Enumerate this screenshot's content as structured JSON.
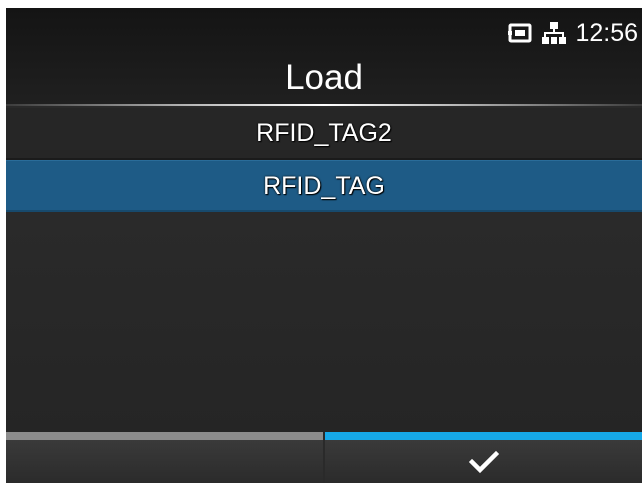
{
  "status_bar": {
    "time": "12:56",
    "icons": [
      "storage-card-icon",
      "network-lan-icon"
    ]
  },
  "header": {
    "title": "Load"
  },
  "list": {
    "items": [
      {
        "label": "RFID_TAG2",
        "selected": false
      },
      {
        "label": "RFID_TAG",
        "selected": true
      }
    ]
  },
  "softkeys": {
    "left": {
      "icon": "none",
      "accent_color": "#8c8c8c"
    },
    "right": {
      "icon": "checkmark-icon",
      "accent_color": "#16a8e8"
    }
  },
  "colors": {
    "selection": "#1e5b86",
    "background": "#2a2a2a"
  }
}
